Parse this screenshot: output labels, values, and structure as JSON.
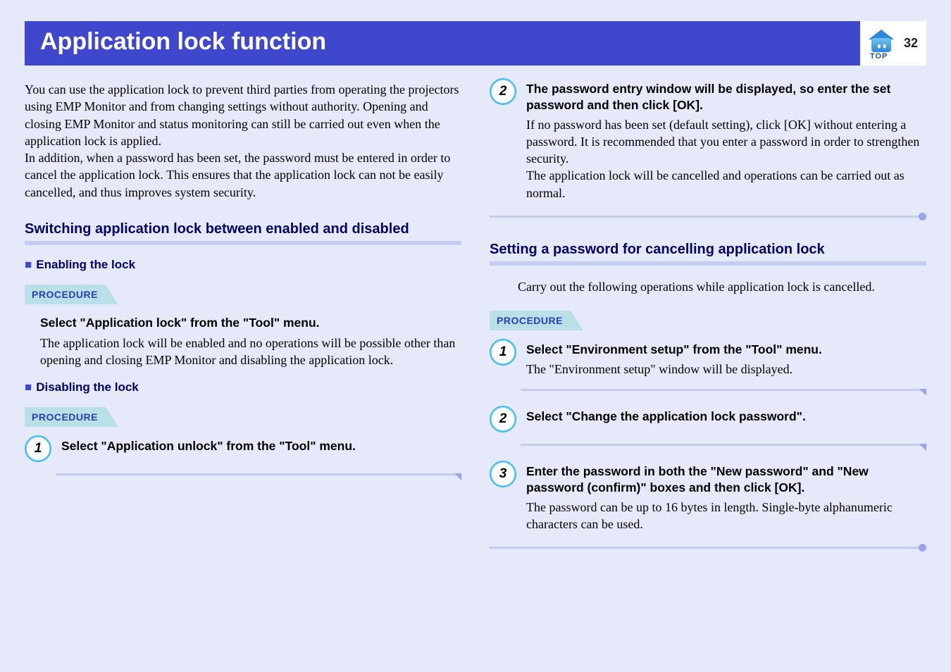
{
  "page_number": "32",
  "top_label": "TOP",
  "title": "Application lock function",
  "intro": "You can use the application lock to prevent third parties from operating the projectors using EMP Monitor and from changing settings without authority. Opening and closing EMP Monitor and status monitoring can still be carried out even when the application lock is applied.\nIn addition, when a password has been set, the password must be entered in order to cancel the application lock. This ensures that the application lock can not be easily cancelled, and thus improves system security.",
  "section_switch": "Switching application lock between enabled and disabled",
  "enable_heading": "Enabling the lock",
  "procedure_label": "PROCEDURE",
  "enable_step_title": "Select \"Application lock\" from the \"Tool\" menu.",
  "enable_step_text": "The application lock will be enabled and no operations will be possible other than opening and closing EMP Monitor and disabling the application lock.",
  "disable_heading": "Disabling the lock",
  "disable_steps": [
    {
      "num": "1",
      "title": "Select \"Application unlock\" from the \"Tool\" menu.",
      "text": ""
    },
    {
      "num": "2",
      "title": "The password entry window will be displayed, so enter the set password and then click [OK].",
      "text": "If no password has been set (default setting), click [OK] without entering a password. It is recommended that you enter a password in order to strengthen security.\nThe application lock will be cancelled and operations can be carried out as normal."
    }
  ],
  "section_password": "Setting a password for cancelling application lock",
  "password_intro": "Carry out the following operations while application lock is cancelled.",
  "password_steps": [
    {
      "num": "1",
      "title": "Select \"Environment setup\" from the \"Tool\" menu.",
      "text": "The \"Environment setup\" window will be displayed."
    },
    {
      "num": "2",
      "title": "Select \"Change the application lock password\".",
      "text": ""
    },
    {
      "num": "3",
      "title": "Enter the password in both the \"New password\" and \"New password (confirm)\" boxes and then click [OK].",
      "text": "The password can be up to 16 bytes in length. Single-byte alphanumeric characters can be used."
    }
  ]
}
